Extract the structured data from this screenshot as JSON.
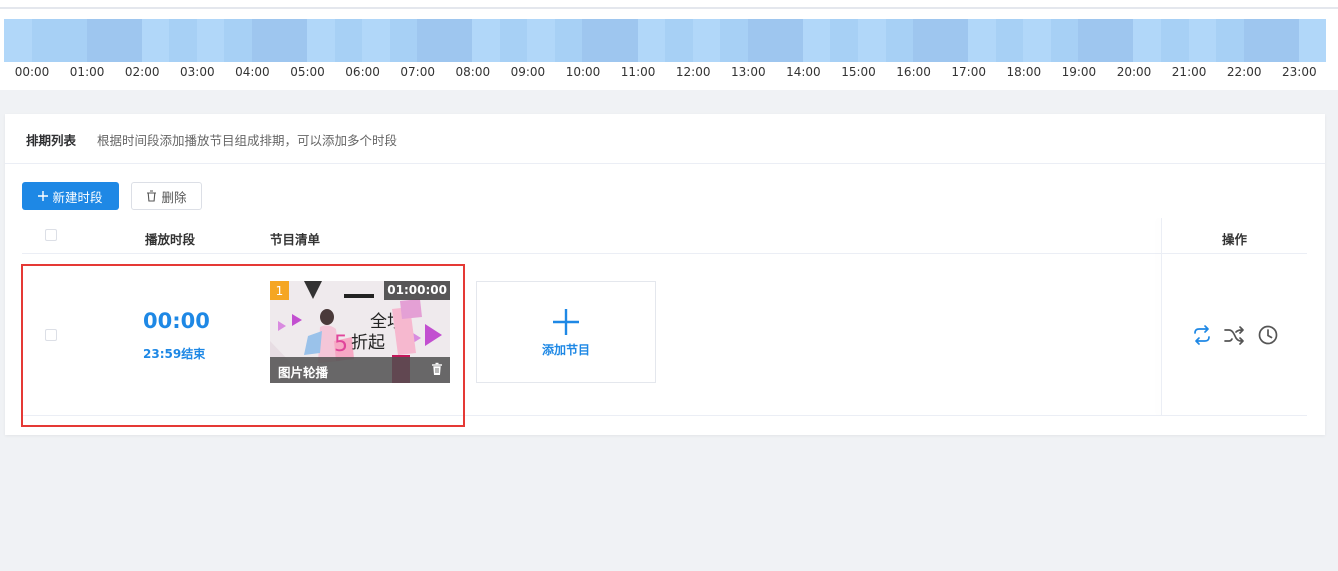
{
  "timeline": {
    "hours": [
      "00:00",
      "01:00",
      "02:00",
      "03:00",
      "04:00",
      "05:00",
      "06:00",
      "07:00",
      "08:00",
      "09:00",
      "10:00",
      "11:00",
      "12:00",
      "13:00",
      "14:00",
      "15:00",
      "16:00",
      "17:00",
      "18:00",
      "19:00",
      "20:00",
      "21:00",
      "22:00",
      "23:00"
    ],
    "colors": {
      "light": "#b1d7f9",
      "mid": "#a7d0f5",
      "dark": "#9ec6ef"
    }
  },
  "schedule": {
    "title": "排期列表",
    "subtitle": "根据时间段添加播放节目组成排期，可以添加多个时段",
    "toolbar": {
      "new_label": "新建时段",
      "delete_label": "删除"
    },
    "columns": {
      "time": "播放时段",
      "programs": "节目清单",
      "actions": "操作"
    },
    "rows": [
      {
        "start": "00:00",
        "end": "23:59结束",
        "programs": [
          {
            "index": "1",
            "duration": "01:00:00",
            "type": "图片轮播",
            "thumbnail": {
              "line1": "全场",
              "line2": "5",
              "line3": "折起"
            }
          }
        ],
        "add_label": "添加节目"
      }
    ],
    "actions": [
      "loop-icon",
      "shuffle-icon",
      "clock-icon"
    ]
  },
  "colors": {
    "primary": "#1e88e5",
    "highlight": "#e53935",
    "badge": "#f5a623"
  }
}
